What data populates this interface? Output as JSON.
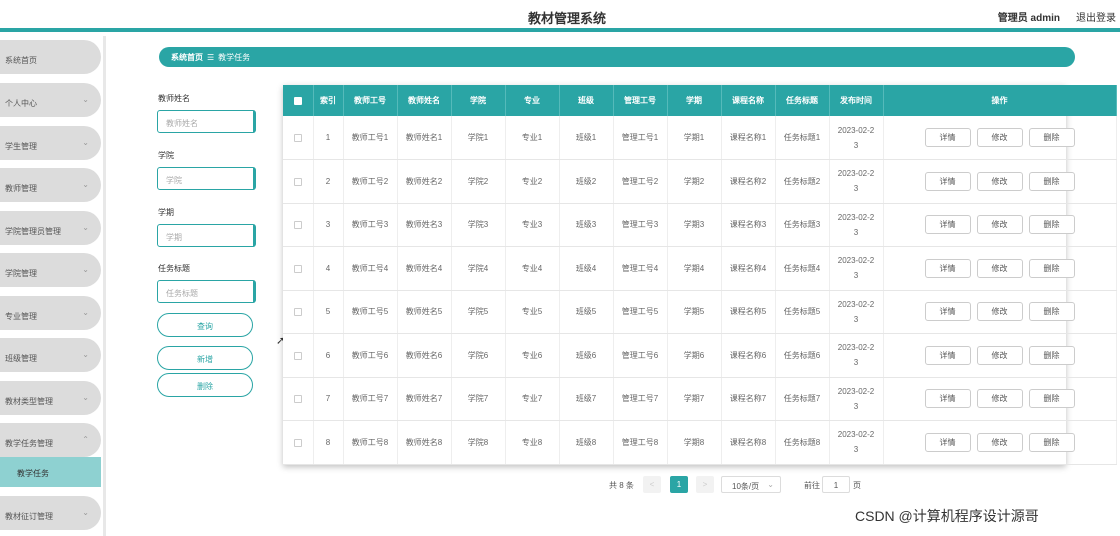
{
  "header": {
    "title": "教材管理系统",
    "user": "管理员 admin",
    "logout": "退出登录"
  },
  "sidebar": {
    "items": [
      {
        "label": "系统首页",
        "chevron": false
      },
      {
        "label": "个人中心",
        "chevron": true
      },
      {
        "label": "学生管理",
        "chevron": true
      },
      {
        "label": "教师管理",
        "chevron": true
      },
      {
        "label": "学院管理员管理",
        "chevron": true
      },
      {
        "label": "学院管理",
        "chevron": true
      },
      {
        "label": "专业管理",
        "chevron": true
      },
      {
        "label": "班级管理",
        "chevron": true
      },
      {
        "label": "教材类型管理",
        "chevron": true
      },
      {
        "label": "教学任务管理",
        "chevron": true,
        "expanded": true
      },
      {
        "label": "教材征订管理",
        "chevron": true
      }
    ],
    "active_sub": "教学任务",
    "chevron_down": "⌄",
    "chevron_up": "⌃"
  },
  "breadcrumb": {
    "home": "系统首页",
    "separator": "☰",
    "current": "教学任务"
  },
  "search": {
    "fields": [
      {
        "label": "教师姓名",
        "placeholder": "教师姓名"
      },
      {
        "label": "学院",
        "placeholder": "学院"
      },
      {
        "label": "学期",
        "placeholder": "学期"
      },
      {
        "label": "任务标题",
        "placeholder": "任务标题"
      }
    ],
    "query_btn": "查询",
    "add_btn": "新增",
    "delete_btn": "删除"
  },
  "table": {
    "headers": [
      "索引",
      "教师工号",
      "教师姓名",
      "学院",
      "专业",
      "班级",
      "管理工号",
      "学期",
      "课程名称",
      "任务标题",
      "发布时间",
      "操作"
    ],
    "rows": [
      {
        "idx": "1",
        "cells": [
          "教师工号1",
          "教师姓名1",
          "学院1",
          "专业1",
          "班级1",
          "管理工号1",
          "学期1",
          "课程名称1",
          "任务标题1"
        ],
        "time": [
          "2023-02-2",
          "3"
        ]
      },
      {
        "idx": "2",
        "cells": [
          "教师工号2",
          "教师姓名2",
          "学院2",
          "专业2",
          "班级2",
          "管理工号2",
          "学期2",
          "课程名称2",
          "任务标题2"
        ],
        "time": [
          "2023-02-2",
          "3"
        ]
      },
      {
        "idx": "3",
        "cells": [
          "教师工号3",
          "教师姓名3",
          "学院3",
          "专业3",
          "班级3",
          "管理工号3",
          "学期3",
          "课程名称3",
          "任务标题3"
        ],
        "time": [
          "2023-02-2",
          "3"
        ]
      },
      {
        "idx": "4",
        "cells": [
          "教师工号4",
          "教师姓名4",
          "学院4",
          "专业4",
          "班级4",
          "管理工号4",
          "学期4",
          "课程名称4",
          "任务标题4"
        ],
        "time": [
          "2023-02-2",
          "3"
        ]
      },
      {
        "idx": "5",
        "cells": [
          "教师工号5",
          "教师姓名5",
          "学院5",
          "专业5",
          "班级5",
          "管理工号5",
          "学期5",
          "课程名称5",
          "任务标题5"
        ],
        "time": [
          "2023-02-2",
          "3"
        ]
      },
      {
        "idx": "6",
        "cells": [
          "教师工号6",
          "教师姓名6",
          "学院6",
          "专业6",
          "班级6",
          "管理工号6",
          "学期6",
          "课程名称6",
          "任务标题6"
        ],
        "time": [
          "2023-02-2",
          "3"
        ]
      },
      {
        "idx": "7",
        "cells": [
          "教师工号7",
          "教师姓名7",
          "学院7",
          "专业7",
          "班级7",
          "管理工号7",
          "学期7",
          "课程名称7",
          "任务标题7"
        ],
        "time": [
          "2023-02-2",
          "3"
        ]
      },
      {
        "idx": "8",
        "cells": [
          "教师工号8",
          "教师姓名8",
          "学院8",
          "专业8",
          "班级8",
          "管理工号8",
          "学期8",
          "课程名称8",
          "任务标题8"
        ],
        "time": [
          "2023-02-2",
          "3"
        ]
      }
    ],
    "actions": {
      "detail": "详情",
      "edit": "修改",
      "delete": "删除"
    }
  },
  "pagination": {
    "total": "共 8 条",
    "prev": "<",
    "current_page": "1",
    "next": ">",
    "page_size": "10条/页",
    "goto_label": "前往",
    "goto_value": "1",
    "page_suffix": "页"
  },
  "watermark": "CSDN @计算机程序设计源哥",
  "colors": {
    "accent": "#2aa5a5",
    "sidebar_item": "#dcdcdc",
    "active_sub": "#8ed1d1"
  }
}
